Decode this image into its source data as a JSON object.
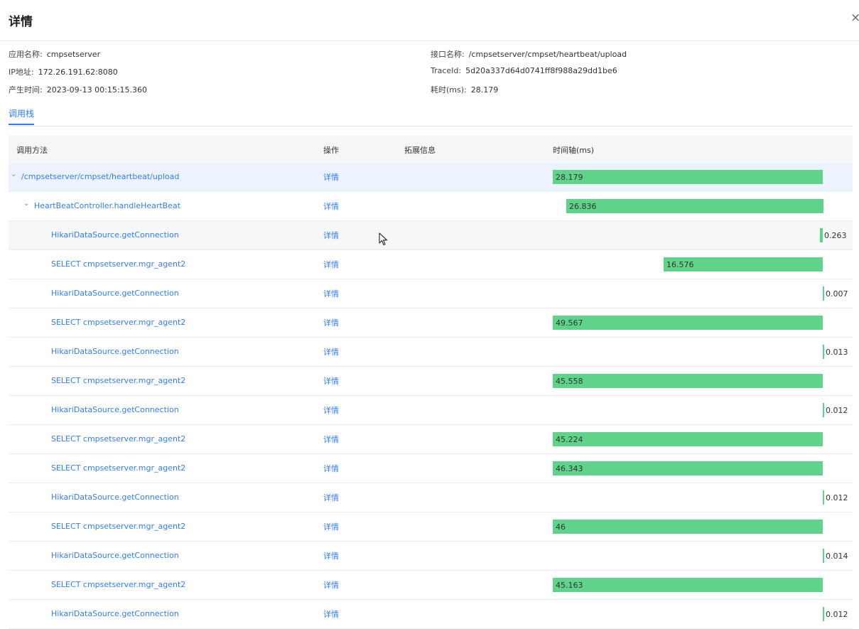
{
  "dialog": {
    "title": "详情",
    "close": "×"
  },
  "info": {
    "app_name_label": "应用名称:",
    "app_name": "cmpsetserver",
    "ip_label": "IP地址:",
    "ip": "172.26.191.62:8080",
    "time_label": "产生时间:",
    "time": "2023-09-13 00:15:15.360",
    "api_label": "接口名称:",
    "api": "/cmpsetserver/cmpset/heartbeat/upload",
    "trace_label": "TraceId:",
    "trace": "5d20a337d64d0741ff8f988a29dd1be6",
    "cost_label": "耗时(ms):",
    "cost": "28.179"
  },
  "tabs": [
    "调用栈"
  ],
  "table": {
    "headers": {
      "method": "调用方法",
      "op": "操作",
      "ext": "拓展信息",
      "timeline": "时间轴(ms)"
    },
    "rows": [
      {
        "method": "/cmpsetserver/cmpset/heartbeat/upload",
        "op": "详情",
        "value": "28.179"
      },
      {
        "method": "HeartBeatController.handleHeartBeat",
        "op": "详情",
        "value": "26.836"
      },
      {
        "method": "HikariDataSource.getConnection",
        "op": "详情",
        "value": "0.263"
      },
      {
        "method": "SELECT cmpsetserver.mgr_agent2",
        "op": "详情",
        "value": "16.576"
      },
      {
        "method": "HikariDataSource.getConnection",
        "op": "详情",
        "value": "0.007"
      },
      {
        "method": "SELECT cmpsetserver.mgr_agent2",
        "op": "详情",
        "value": "49.567"
      },
      {
        "method": "HikariDataSource.getConnection",
        "op": "详情",
        "value": "0.013"
      },
      {
        "method": "SELECT cmpsetserver.mgr_agent2",
        "op": "详情",
        "value": "45.558"
      },
      {
        "method": "HikariDataSource.getConnection",
        "op": "详情",
        "value": "0.012"
      },
      {
        "method": "SELECT cmpsetserver.mgr_agent2",
        "op": "详情",
        "value": "45.224"
      },
      {
        "method": "SELECT cmpsetserver.mgr_agent2",
        "op": "详情",
        "value": "46.343"
      },
      {
        "method": "HikariDataSource.getConnection",
        "op": "详情",
        "value": "0.012"
      },
      {
        "method": "SELECT cmpsetserver.mgr_agent2",
        "op": "详情",
        "value": "46"
      },
      {
        "method": "HikariDataSource.getConnection",
        "op": "详情",
        "value": "0.014"
      },
      {
        "method": "SELECT cmpsetserver.mgr_agent2",
        "op": "详情",
        "value": "45.163"
      },
      {
        "method": "HikariDataSource.getConnection",
        "op": "详情",
        "value": "0.012"
      }
    ]
  },
  "colors": {
    "accent": "#2f7df6",
    "bar": "#5fd38a"
  },
  "icons": {
    "expand": "chevron-down-icon",
    "close": "close-icon",
    "cursor": "mouse-pointer-icon"
  }
}
